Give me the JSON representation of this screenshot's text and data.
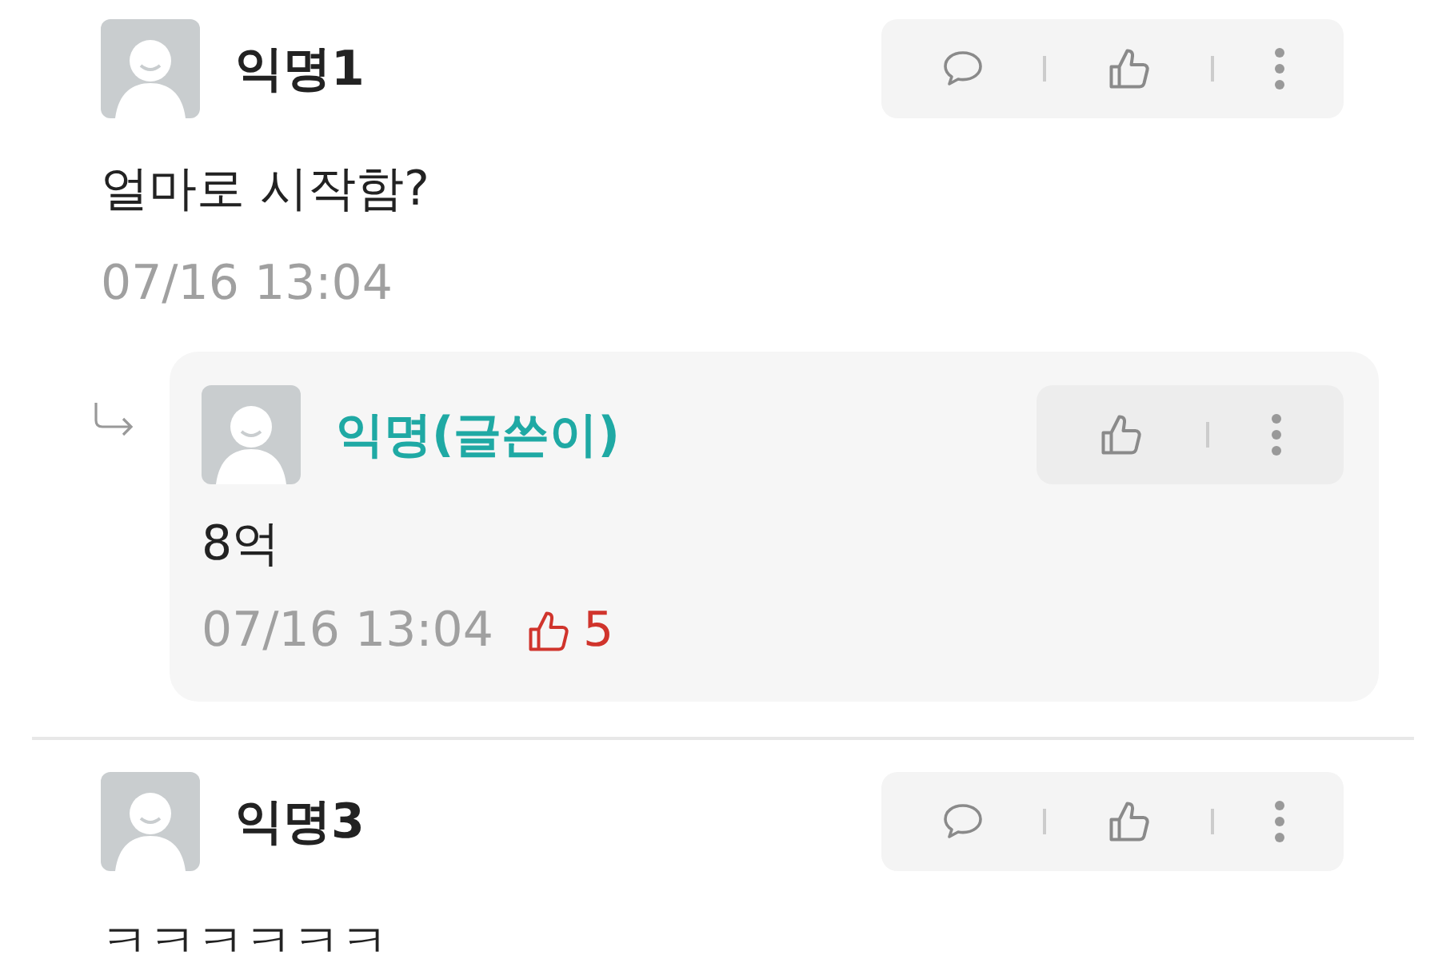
{
  "comments": [
    {
      "author": "익명1",
      "is_writer": false,
      "body": "얼마로 시작함?",
      "time": "07/16 13:04",
      "actions": [
        {
          "kind": "reply"
        },
        {
          "kind": "like"
        },
        {
          "kind": "more"
        }
      ],
      "replies": [
        {
          "author": "익명(글쓴이)",
          "is_writer": true,
          "body": "8억",
          "time": "07/16 13:04",
          "likes": "5",
          "actions": [
            {
              "kind": "like"
            },
            {
              "kind": "more"
            }
          ]
        }
      ]
    },
    {
      "author": "익명3",
      "is_writer": false,
      "body": "ㅋㅋㅋㅋㅋㅋ",
      "actions": [
        {
          "kind": "reply"
        },
        {
          "kind": "like"
        },
        {
          "kind": "more"
        }
      ]
    }
  ]
}
